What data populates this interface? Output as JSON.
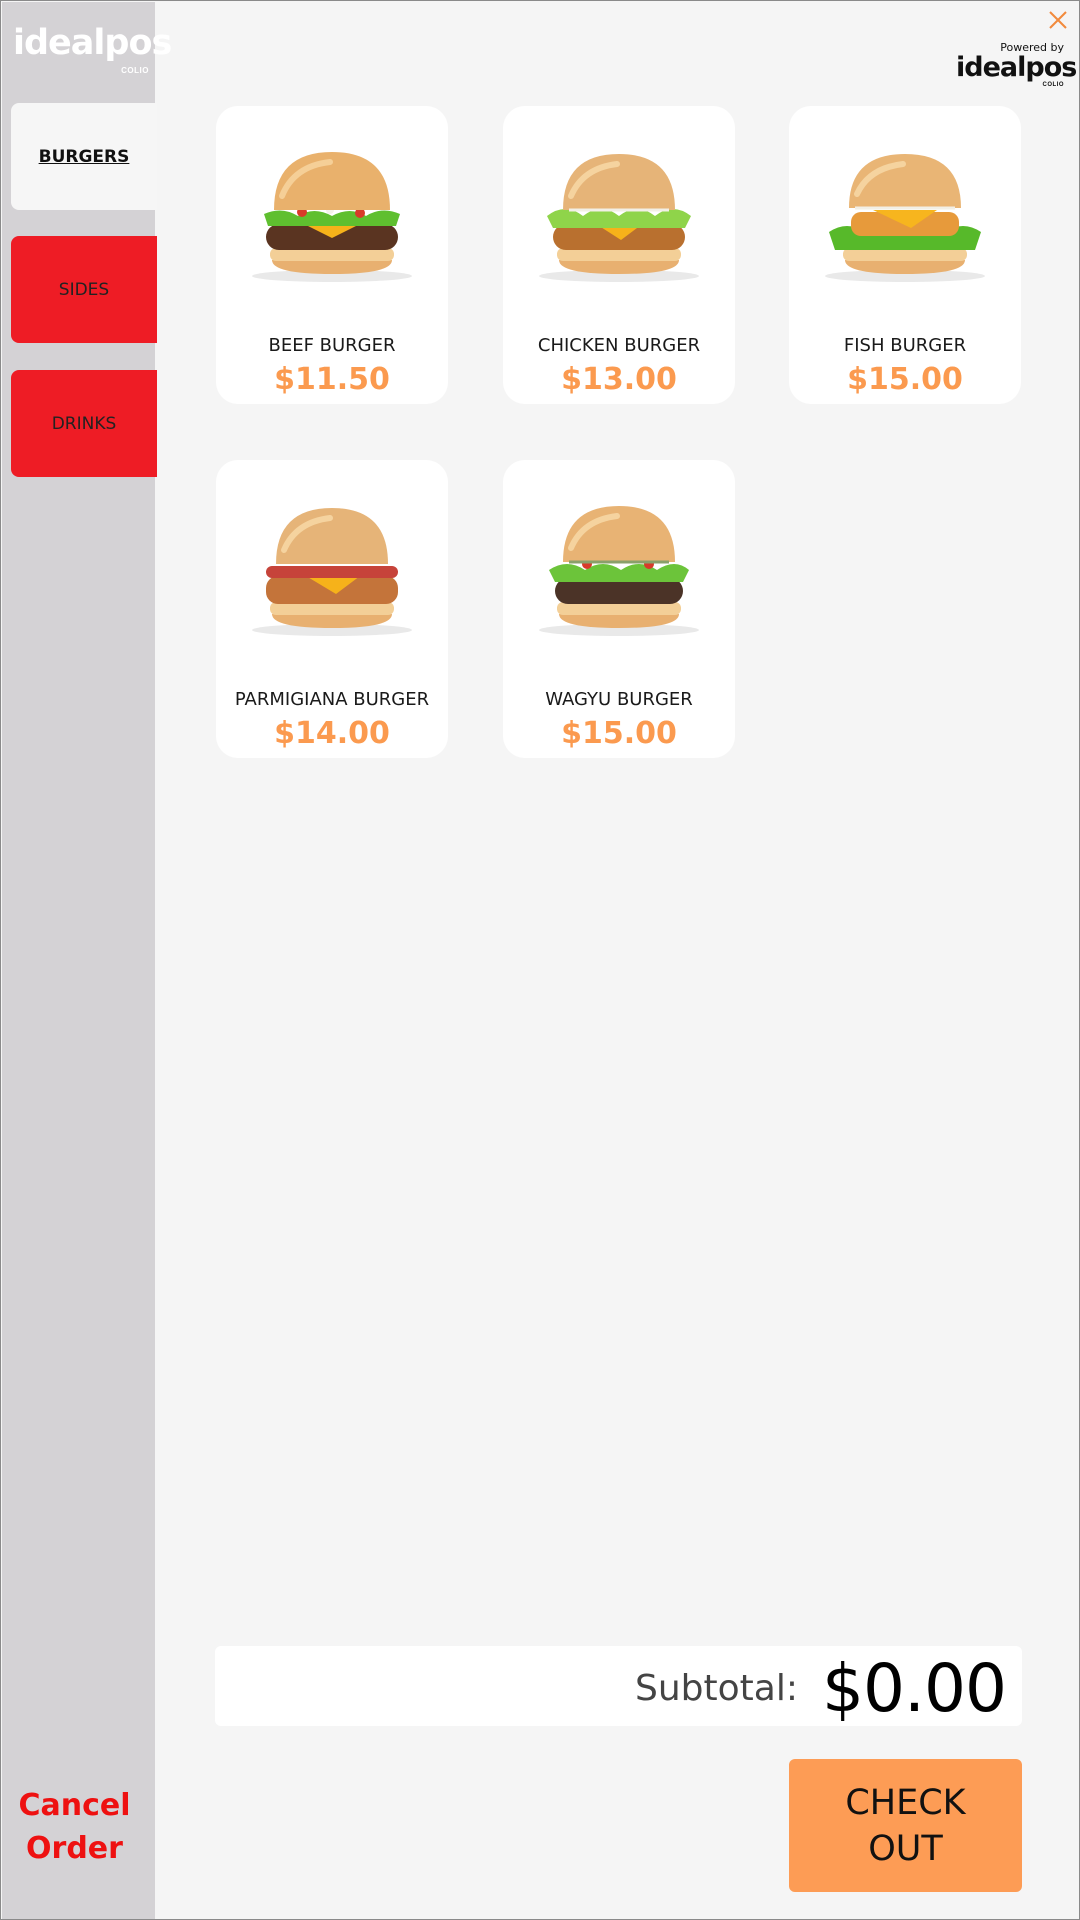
{
  "brand": {
    "logo_text": "idealpos",
    "logo_sub": "COLIO"
  },
  "powered_by": {
    "label": "Powered by",
    "logo_text": "idealpos",
    "logo_sub": "COLIO"
  },
  "categories": [
    {
      "label": "BURGERS",
      "active": true
    },
    {
      "label": "SIDES",
      "active": false
    },
    {
      "label": "DRINKS",
      "active": false
    }
  ],
  "products": [
    {
      "name": "BEEF BURGER",
      "price": "$11.50",
      "patty": "beef"
    },
    {
      "name": "CHICKEN BURGER",
      "price": "$13.00",
      "patty": "chicken"
    },
    {
      "name": "FISH BURGER",
      "price": "$15.00",
      "patty": "fish"
    },
    {
      "name": "PARMIGIANA BURGER",
      "price": "$14.00",
      "patty": "parmigiana"
    },
    {
      "name": "WAGYU BURGER",
      "price": "$15.00",
      "patty": "wagyu"
    }
  ],
  "subtotal": {
    "label": "Subtotal:",
    "value": "$0.00"
  },
  "checkout": {
    "line1": "CHECK",
    "line2": "OUT"
  },
  "cancel": {
    "line1": "Cancel",
    "line2": "Order"
  },
  "colors": {
    "accent_orange": "#fd9c55",
    "price_orange": "#fb9a4f",
    "category_red": "#ee1c25",
    "cancel_red": "#ee1111",
    "sidebar_gray": "#d4d2d5"
  }
}
